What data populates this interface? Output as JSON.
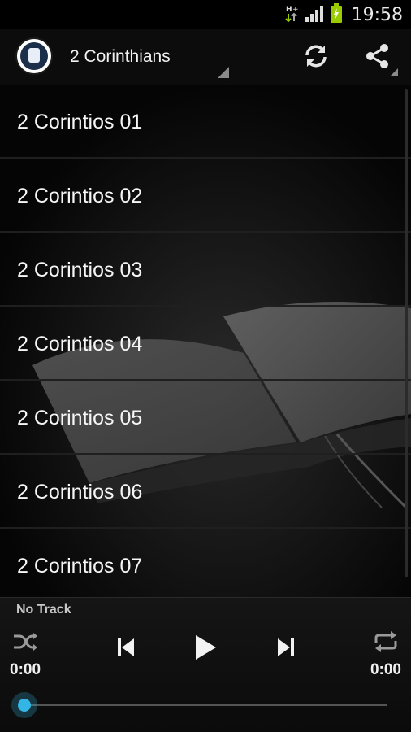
{
  "status_bar": {
    "time": "19:58",
    "icons": [
      "data-transfer-icon",
      "signal-icon",
      "battery-charging-icon"
    ]
  },
  "action_bar": {
    "title": "2 Corinthians",
    "icons": [
      "app-logo-icon",
      "refresh-icon",
      "share-icon"
    ]
  },
  "list": {
    "items": [
      {
        "label": "2 Corintios 01"
      },
      {
        "label": "2 Corintios 02"
      },
      {
        "label": "2 Corintios 03"
      },
      {
        "label": "2 Corintios 04"
      },
      {
        "label": "2 Corintios 05"
      },
      {
        "label": "2 Corintios 06"
      },
      {
        "label": "2 Corintios 07"
      }
    ]
  },
  "player": {
    "track": "No Track",
    "elapsed": "0:00",
    "duration": "0:00",
    "progress": 0,
    "icons": [
      "shuffle-icon",
      "previous-icon",
      "play-icon",
      "next-icon",
      "repeat-icon"
    ]
  },
  "colors": {
    "accent": "#33b5e5",
    "background": "#000000",
    "battery": "#99cc00"
  }
}
